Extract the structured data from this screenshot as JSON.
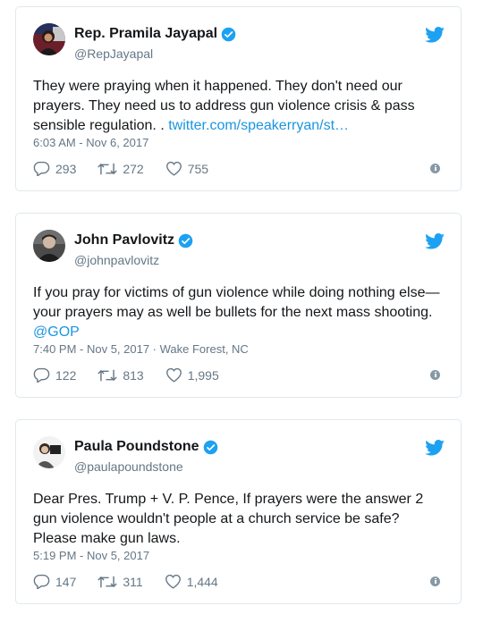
{
  "colors": {
    "link": "#1b95e0",
    "muted": "#657786",
    "verified": "#1da1f2",
    "border": "#e1e8ed"
  },
  "icons": [
    "avatar",
    "verified-badge-icon",
    "twitter-bird-icon",
    "reply-icon",
    "retweet-icon",
    "like-icon",
    "info-icon"
  ],
  "tweets": [
    {
      "name": "Rep. Pramila Jayapal",
      "handle": "@RepJayapal",
      "text": "They were praying when it happened. They don't need our prayers. They need us to address gun violence crisis & pass sensible regulation. . ",
      "link": "twitter.com/speakerryan/st…",
      "meta": "6:03 AM - Nov 6, 2017",
      "replies": "293",
      "retweets": "272",
      "likes": "755"
    },
    {
      "name": "John Pavlovitz",
      "handle": "@johnpavlovitz",
      "text": "If you pray for victims of gun violence while doing nothing else—your prayers may as well be bullets for the next mass shooting. ",
      "link": "@GOP",
      "meta": "7:40 PM - Nov 5, 2017 · Wake Forest, NC",
      "replies": "122",
      "retweets": "813",
      "likes": "1,995"
    },
    {
      "name": "Paula Poundstone",
      "handle": "@paulapoundstone",
      "text": "Dear Pres. Trump + V. P. Pence, If prayers were the answer 2 gun violence wouldn't people at a church service be safe? Please make gun laws.",
      "link": "",
      "meta": "5:19 PM - Nov 5, 2017",
      "replies": "147",
      "retweets": "311",
      "likes": "1,444"
    }
  ]
}
